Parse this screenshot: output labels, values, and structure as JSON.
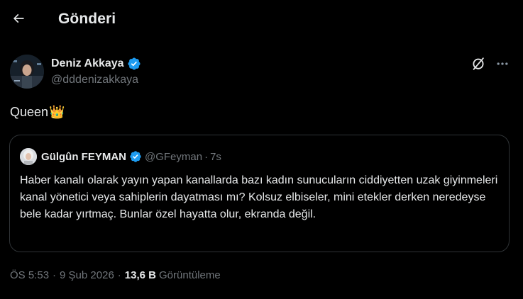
{
  "header": {
    "title": "Gönderi"
  },
  "post": {
    "author_name": "Deniz Akkaya",
    "author_handle": "@dddenizakkaya",
    "text": "Queen",
    "emoji": "👑"
  },
  "quote": {
    "author_name": "Gülgûn FEYMAN",
    "author_handle": "@GFeyman",
    "separator": "·",
    "time": "7s",
    "text": "Haber kanalı olarak yayın yapan kanallarda  bazı kadın sunucuların ciddiyetten uzak giyinmeleri kanal yönetici veya sahiplerin dayatması mı? Kolsuz elbiseler, mini etekler derken neredeyse bele kadar yırtmaç. Bunlar özel hayatta olur, ekranda değil."
  },
  "meta": {
    "time": "ÖS 5:53",
    "separator": "·",
    "date": "9 Şub 2026",
    "views_count": "13,6 B",
    "views_label": "Görüntüleme"
  },
  "colors": {
    "background": "#000000",
    "text": "#e7e9ea",
    "muted": "#71767b",
    "border": "#2f3336",
    "verified": "#1d9bf0"
  },
  "icons": {
    "back": "arrow-left-icon",
    "verified": "verified-badge-icon",
    "grok": "grok-icon",
    "more": "more-horizontal-icon"
  }
}
